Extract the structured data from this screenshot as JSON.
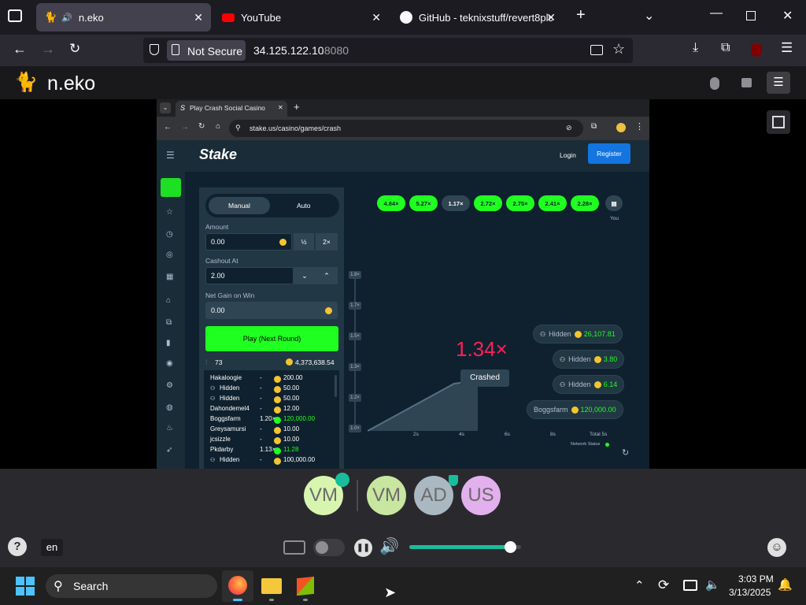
{
  "browser": {
    "tabs": [
      {
        "label": "n.eko",
        "active": true
      },
      {
        "label": "YouTube",
        "active": false
      },
      {
        "label": "GitHub - teknixstuff/revert8plus",
        "active": false
      }
    ],
    "security_label": "Not Secure",
    "url_host": "34.125.122.10",
    "url_port": ":8080"
  },
  "neko": {
    "logo_text": "n.eko",
    "language": "en",
    "members": [
      {
        "initials": "VM",
        "color": "#d8f5b0",
        "badge": "person"
      },
      {
        "initials": "VM",
        "color": "#c8e6a0",
        "badge": ""
      },
      {
        "initials": "AD",
        "color": "#aab8c2",
        "badge": "shield"
      },
      {
        "initials": "US",
        "color": "#e3b0ee",
        "badge": ""
      }
    ],
    "volume_fraction": 0.9
  },
  "remote": {
    "tab_title": "Play Crash Social Casino",
    "url": "stake.us/casino/games/crash"
  },
  "stake": {
    "logo": "Stake",
    "login": "Login",
    "register": "Register",
    "mode_manual": "Manual",
    "mode_auto": "Auto",
    "amount_label": "Amount",
    "amount_value": "0.00",
    "half": "½",
    "double": "2×",
    "cashout_label": "Cashout At",
    "cashout_value": "2.00",
    "netgain_label": "Net Gain on Win",
    "netgain_value": "0.00",
    "play_button": "Play (Next Round)",
    "players_count": "73",
    "total_bet": "4,373,638.54",
    "players": [
      {
        "name": "Hakaloogie",
        "mult": "-",
        "amount": "200.00",
        "green": false,
        "hidden": false
      },
      {
        "name": "Hidden",
        "mult": "-",
        "amount": "50.00",
        "green": false,
        "hidden": true
      },
      {
        "name": "Hidden",
        "mult": "-",
        "amount": "50.00",
        "green": false,
        "hidden": true
      },
      {
        "name": "Dahondemel4",
        "mult": "-",
        "amount": "12.00",
        "green": false,
        "hidden": false
      },
      {
        "name": "Boggsfarm",
        "mult": "1.20×",
        "amount": "120,000.00",
        "green": true,
        "hidden": false
      },
      {
        "name": "Greysamursi",
        "mult": "-",
        "amount": "10.00",
        "green": false,
        "hidden": false
      },
      {
        "name": "jcsizzle",
        "mult": "-",
        "amount": "10.00",
        "green": false,
        "hidden": false
      },
      {
        "name": "Pkdarby",
        "mult": "1.13×",
        "amount": "11.28",
        "green": true,
        "hidden": false
      },
      {
        "name": "Hidden",
        "mult": "-",
        "amount": "100,000.00",
        "green": false,
        "hidden": true
      }
    ],
    "history": [
      {
        "label": "4.84×",
        "color": "#1fff20"
      },
      {
        "label": "5.27×",
        "color": "#1fff20"
      },
      {
        "label": "1.17×",
        "color": "#2f4553"
      },
      {
        "label": "2.72×",
        "color": "#1fff20"
      },
      {
        "label": "2.75×",
        "color": "#1fff20"
      },
      {
        "label": "2.41×",
        "color": "#1fff20"
      },
      {
        "label": "2.28×",
        "color": "#1fff20"
      }
    ],
    "you_label": "You",
    "crash_multiplier": "1.34×",
    "crashed_label": "Crashed",
    "y_ticks": [
      "1.8×",
      "1.7×",
      "1.5×",
      "1.3×",
      "1.2×",
      "1.0×"
    ],
    "x_ticks": [
      "2s",
      "4s",
      "6s",
      "8s",
      "Total 5s"
    ],
    "network_status": "Network Status",
    "cashouts": [
      {
        "name": "Hidden",
        "amount": "26,107.81"
      },
      {
        "name": "Hidden",
        "amount": "3.80"
      },
      {
        "name": "Hidden",
        "amount": "6.14"
      },
      {
        "name": "Boggsfarm",
        "amount": "120,000.00"
      }
    ]
  },
  "taskbar": {
    "search_placeholder": "Search",
    "time": "3:03 PM",
    "date": "3/13/2025"
  }
}
